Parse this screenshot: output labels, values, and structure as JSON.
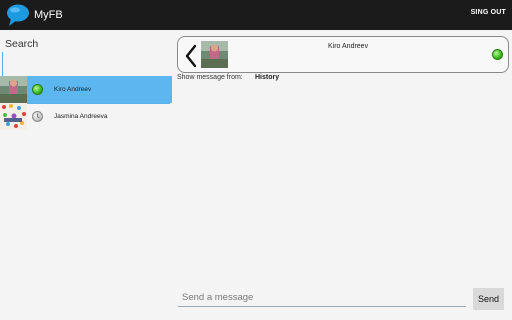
{
  "actionbar": {
    "app_title": "MyFB",
    "signout_label": "SING OUT",
    "icon": "chat-bubble-icon"
  },
  "sidebar": {
    "search_label": "Search",
    "contacts": [
      {
        "name": "Kiro Andreev",
        "status": "online",
        "selected": true
      },
      {
        "name": "Jasmina Andreeva",
        "status": "away",
        "selected": false
      }
    ]
  },
  "chat": {
    "contact_name": "Kiro Andreev",
    "status": "online",
    "show_from_label": "Show message from:",
    "history_label": "History",
    "message_placeholder": "Send a message",
    "send_label": "Send"
  },
  "colors": {
    "actionbar": "#1b1b1b",
    "selected_row": "#5cb7f0",
    "online": "#3fc21c",
    "away": "#c8c8c8"
  }
}
